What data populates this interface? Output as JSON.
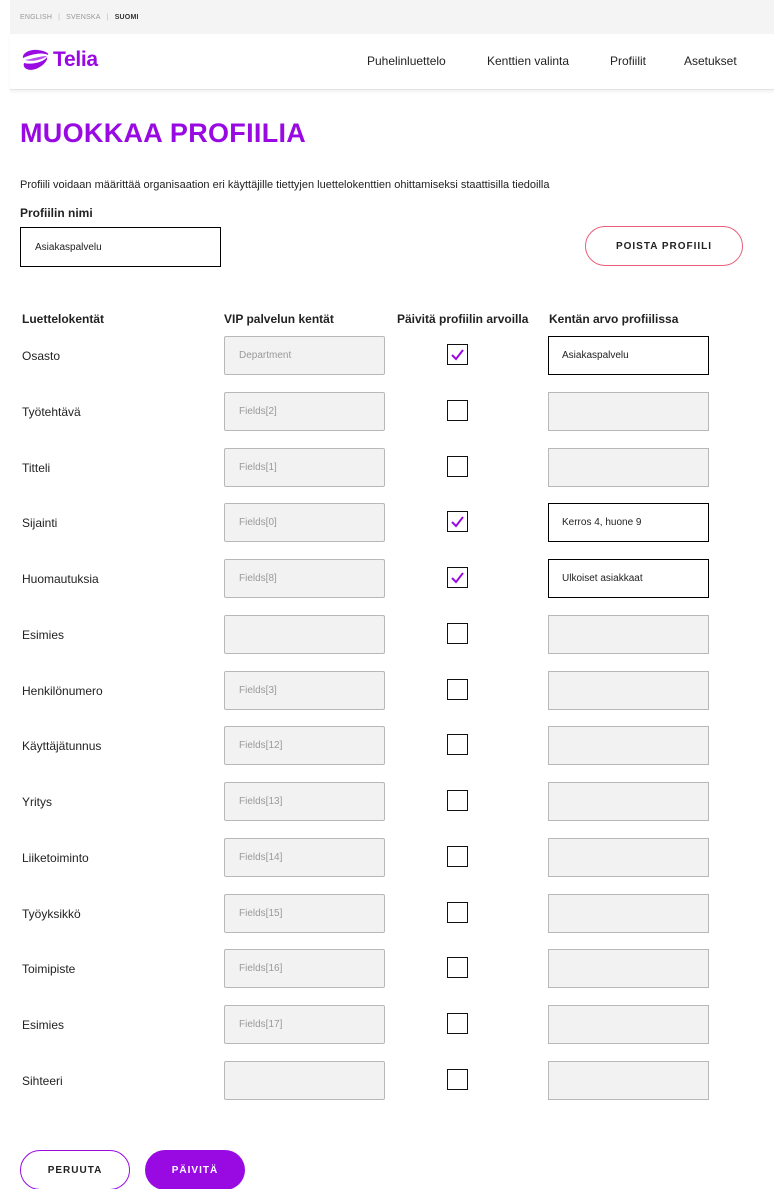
{
  "languages": [
    {
      "label": "ENGLISH",
      "active": false
    },
    {
      "label": "SVENSKA",
      "active": false
    },
    {
      "label": "SUOMI",
      "active": true
    }
  ],
  "header": {
    "brand": "Telia",
    "nav": [
      "Puhelinluettelo",
      "Kenttien valinta",
      "Profiilit",
      "Asetukset"
    ]
  },
  "page": {
    "title": "MUOKKAA PROFIILIA",
    "description": "Profiili voidaan määrittää organisaation eri käyttäjille tiettyjen luettelokenttien ohittamiseksi staattisilla tiedoilla",
    "name_label": "Profiilin nimi",
    "name_value": "Asiakaspalvelu",
    "delete_label": "POISTA PROFIILI"
  },
  "table": {
    "headers": [
      "Luettelokentät",
      "VIP palvelun kentät",
      "Päivitä profiilin arvoilla",
      "Kentän arvo profiilissa"
    ],
    "rows": [
      {
        "label": "Osasto",
        "vip": "Department",
        "checked": true,
        "value": "Asiakaspalvelu"
      },
      {
        "label": "Työtehtävä",
        "vip": "Fields[2]",
        "checked": false,
        "value": ""
      },
      {
        "label": "Titteli",
        "vip": "Fields[1]",
        "checked": false,
        "value": ""
      },
      {
        "label": "Sijainti",
        "vip": "Fields[0]",
        "checked": true,
        "value": "Kerros 4, huone 9"
      },
      {
        "label": "Huomautuksia",
        "vip": "Fields[8]",
        "checked": true,
        "value": "Ulkoiset asiakkaat"
      },
      {
        "label": "Esimies",
        "vip": "",
        "checked": false,
        "value": ""
      },
      {
        "label": "Henkilönumero",
        "vip": "Fields[3]",
        "checked": false,
        "value": ""
      },
      {
        "label": "Käyttäjätunnus",
        "vip": "Fields[12]",
        "checked": false,
        "value": ""
      },
      {
        "label": "Yritys",
        "vip": "Fields[13]",
        "checked": false,
        "value": ""
      },
      {
        "label": "Liiketoiminto",
        "vip": "Fields[14]",
        "checked": false,
        "value": ""
      },
      {
        "label": "Työyksikkö",
        "vip": "Fields[15]",
        "checked": false,
        "value": ""
      },
      {
        "label": "Toimipiste",
        "vip": "Fields[16]",
        "checked": false,
        "value": ""
      },
      {
        "label": "Esimies",
        "vip": "Fields[17]",
        "checked": false,
        "value": ""
      },
      {
        "label": "Sihteeri",
        "vip": "",
        "checked": false,
        "value": ""
      }
    ]
  },
  "actions": {
    "cancel_label": "PERUUTA",
    "update_label": "PÄIVITÄ"
  },
  "colors": {
    "brand_purple": "#990ae3",
    "delete_border": "#e8607c"
  }
}
